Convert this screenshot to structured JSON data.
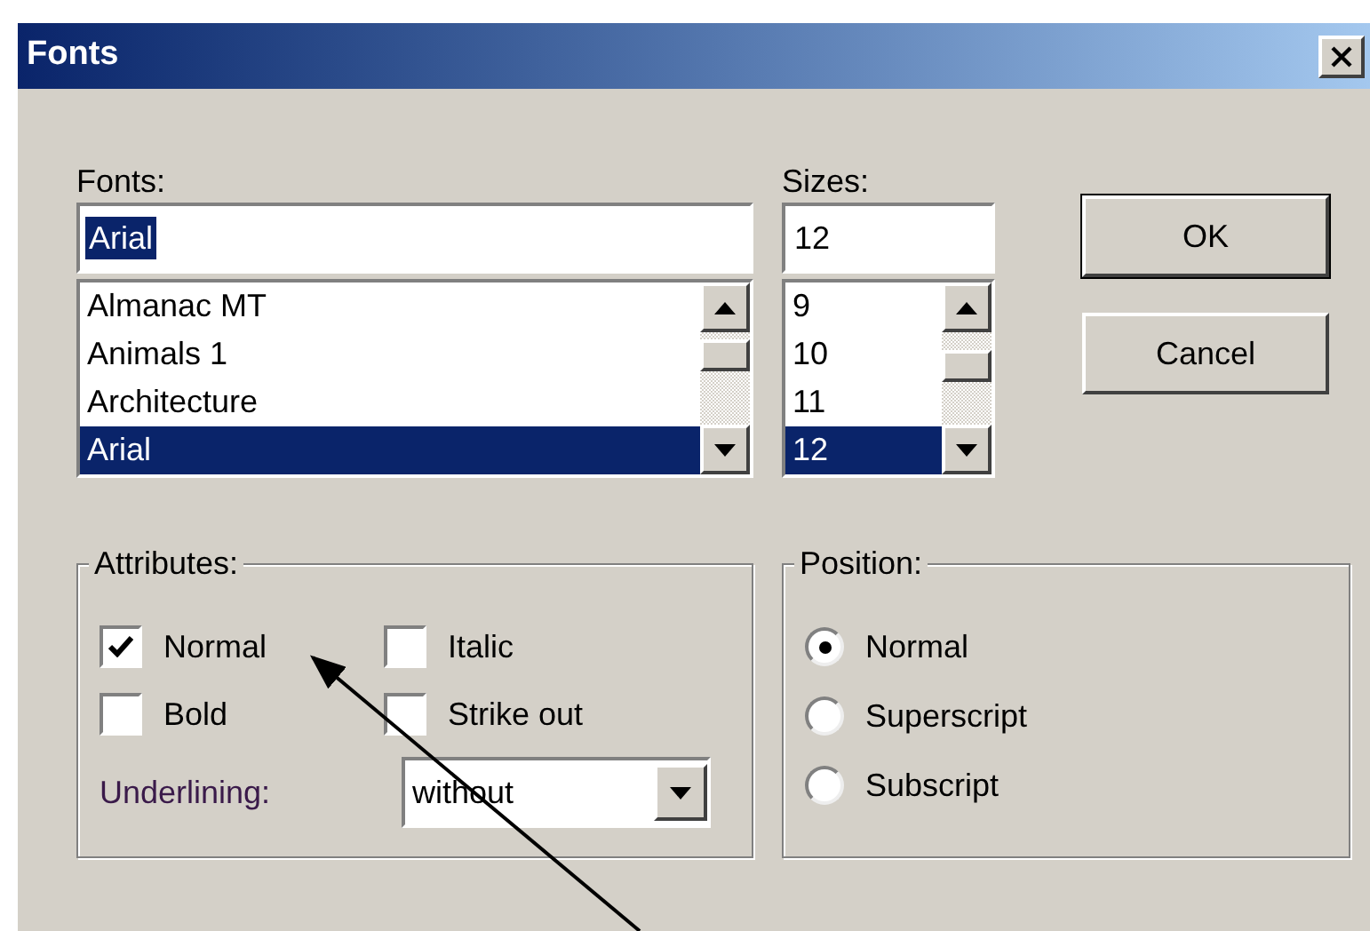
{
  "window": {
    "title": "Fonts"
  },
  "fonts": {
    "label": "Fonts:",
    "value": "Arial",
    "value_selected": true,
    "items": [
      {
        "label": "Almanac MT",
        "selected": false
      },
      {
        "label": "Animals 1",
        "selected": false
      },
      {
        "label": "Architecture",
        "selected": false
      },
      {
        "label": "Arial",
        "selected": true
      }
    ]
  },
  "sizes": {
    "label": "Sizes:",
    "value": "12",
    "value_selected": false,
    "items": [
      {
        "label": "9",
        "selected": false
      },
      {
        "label": "10",
        "selected": false
      },
      {
        "label": "11",
        "selected": false
      },
      {
        "label": "12",
        "selected": true
      }
    ]
  },
  "buttons": [
    "OK",
    "Cancel"
  ],
  "attributes": {
    "title": "Attributes:",
    "checkboxes": [
      {
        "label": "Normal",
        "checked": true
      },
      {
        "label": "Italic",
        "checked": false
      },
      {
        "label": "Bold",
        "checked": false
      },
      {
        "label": "Strike out",
        "checked": false
      }
    ],
    "underlining": {
      "label": "Underlining:",
      "value": "without"
    }
  },
  "position": {
    "title": "Position:",
    "options": [
      {
        "label": "Normal",
        "selected": true
      },
      {
        "label": "Superscript",
        "selected": false
      },
      {
        "label": "Subscript",
        "selected": false
      }
    ]
  }
}
